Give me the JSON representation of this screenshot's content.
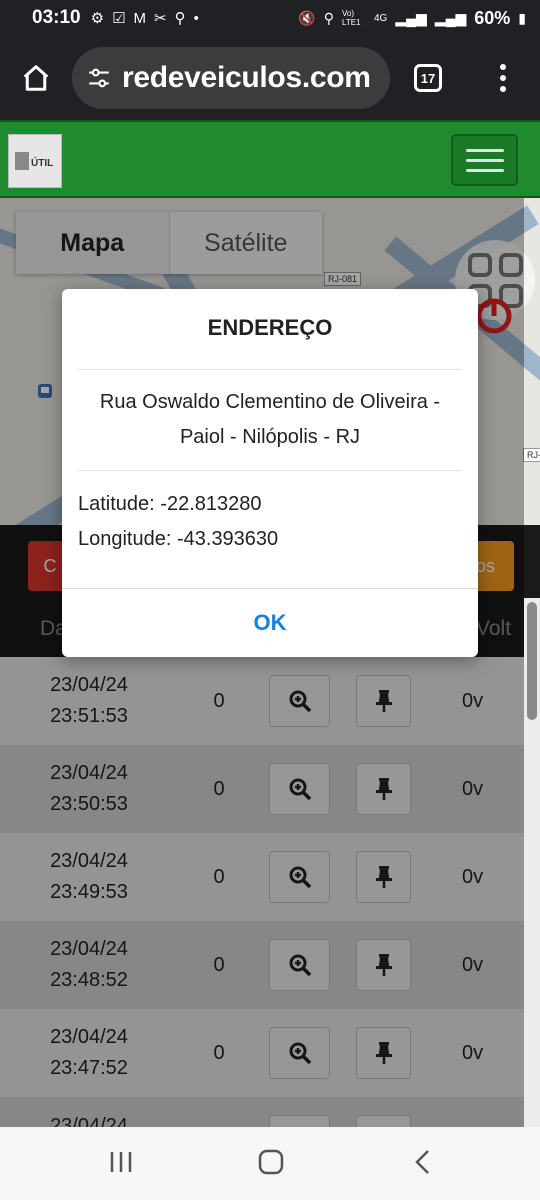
{
  "status_bar": {
    "time": "03:10",
    "battery": "60%",
    "network": "4G",
    "volte": "Vo) LTE1"
  },
  "browser": {
    "url": "redeveiculos.com",
    "tab_count": "17"
  },
  "map": {
    "tabs": [
      {
        "label": "Mapa"
      },
      {
        "label": "Satélite"
      }
    ],
    "road_labels": [
      "RJ-081",
      "RJ-"
    ]
  },
  "actions": {
    "left_button": "C",
    "right_button": "os"
  },
  "table_headers": {
    "date": "Da",
    "volt": "Volt"
  },
  "rows": [
    {
      "date": "23/04/24",
      "time": "23:51:53",
      "speed": "0",
      "volt": "0v"
    },
    {
      "date": "23/04/24",
      "time": "23:50:53",
      "speed": "0",
      "volt": "0v"
    },
    {
      "date": "23/04/24",
      "time": "23:49:53",
      "speed": "0",
      "volt": "0v"
    },
    {
      "date": "23/04/24",
      "time": "23:48:52",
      "speed": "0",
      "volt": "0v"
    },
    {
      "date": "23/04/24",
      "time": "23:47:52",
      "speed": "0",
      "volt": "0v"
    },
    {
      "date": "23/04/24",
      "time": "",
      "speed": "",
      "volt": ""
    }
  ],
  "dialog": {
    "title": "ENDEREÇO",
    "address_line1": "Rua Oswaldo Clementino de Oliveira -",
    "address_line2": "Paiol - Nilópolis - RJ",
    "latitude": "Latitude: -22.813280",
    "longitude": "Longitude: -43.393630",
    "ok_label": "OK"
  },
  "colors": {
    "brand_green": "#1f8a2e",
    "danger": "#d9342b",
    "warning": "#f39a1e",
    "ok_blue": "#1a7fe0"
  }
}
